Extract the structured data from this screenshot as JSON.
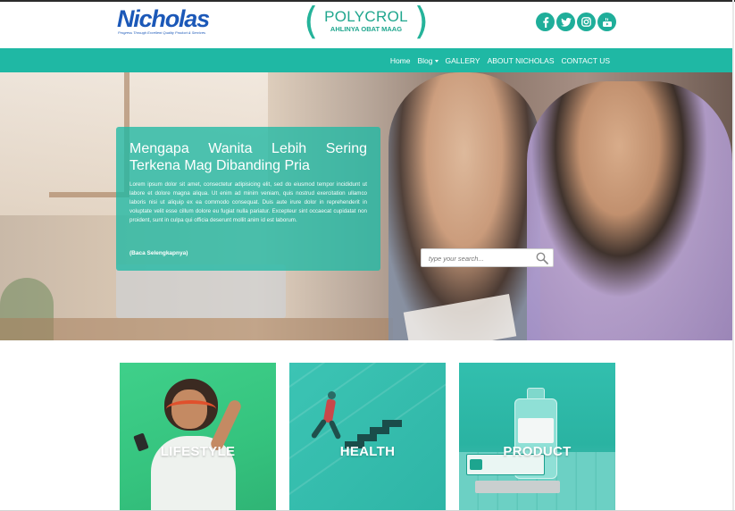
{
  "header": {
    "logo_text": "Nicholas",
    "logo_tagline": "Progress Through Excellent Quality Product & Services",
    "brand_name": "POLYCROL",
    "brand_tagline": "AHLINYA OBAT MAAG",
    "social": [
      {
        "icon": "facebook-icon",
        "glyph": "f"
      },
      {
        "icon": "twitter-icon",
        "glyph": "t"
      },
      {
        "icon": "instagram-icon",
        "glyph": ""
      },
      {
        "icon": "youtube-icon",
        "glyph": ""
      }
    ]
  },
  "nav": {
    "items": [
      {
        "label": "Home"
      },
      {
        "label": "Blog"
      },
      {
        "label": "GALLERY"
      },
      {
        "label": "ABOUT NICHOLAS"
      },
      {
        "label": "CONTACT US"
      }
    ],
    "color": "#1fb8a4"
  },
  "hero": {
    "title": "Mengapa Wanita Lebih Sering Terkena Mag Dibanding Pria",
    "body": "Lorem ipsum dolor sit amet, consectetur adipisicing elit, sed do eiusmod tempor incididunt ut labore et dolore magna aliqua. Ut enim ad minim veniam, quis nostrud exercitation ullamco laboris nisi ut aliquip ex ea commodo consequat. Duis aute irure dolor in reprehenderit in voluptate velit esse cillum dolore eu fugiat nulla pariatur. Excepteur sint occaecat cupidatat non proident, sunt in culpa qui officia deserunt mollit anim id est laborum.",
    "read_more": "(Baca Selengkapnya)",
    "search_placeholder": "type your search..."
  },
  "tiles": [
    {
      "label": "LIFESTYLE"
    },
    {
      "label": "HEALTH"
    },
    {
      "label": "PRODUCT"
    }
  ],
  "colors": {
    "accent": "#1fb8a4",
    "logo_blue": "#1b58b8"
  }
}
